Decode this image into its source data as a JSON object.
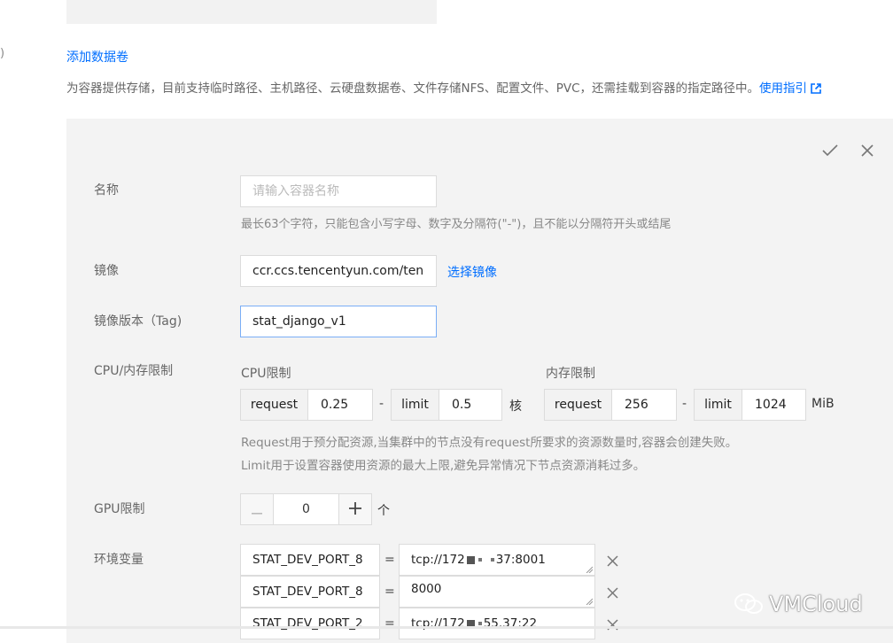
{
  "add_volume": {
    "link": "添加数据卷",
    "description": "为容器提供存储，目前支持临时路径、主机路径、云硬盘数据卷、文件存储NFS、配置文件、PVC，还需挂载到容器的指定路径中。",
    "guide_link": "使用指引"
  },
  "left_marker": ")",
  "container": {
    "name": {
      "label": "名称",
      "placeholder": "请输入容器名称",
      "hint": "最长63个字符，只能包含小写字母、数字及分隔符(\"-\")，且不能以分隔符开头或结尾"
    },
    "image": {
      "label": "镜像",
      "value": "ccr.ccs.tencentyun.com/tence",
      "select_link": "选择镜像"
    },
    "tag": {
      "label": "镜像版本（Tag)",
      "value": "stat_django_v1"
    },
    "resources": {
      "label": "CPU/内存限制",
      "cpu": {
        "title": "CPU限制",
        "request_label": "request",
        "request_value": "0.25",
        "limit_label": "limit",
        "limit_value": "0.5",
        "unit": "核"
      },
      "memory": {
        "title": "内存限制",
        "request_label": "request",
        "request_value": "256",
        "limit_label": "limit",
        "limit_value": "1024",
        "unit": "MiB"
      },
      "dash": "-",
      "hint_line1": "Request用于预分配资源,当集群中的节点没有request所要求的资源数量时,容器会创建失败。",
      "hint_line2": "Limit用于设置容器使用资源的最大上限,避免异常情况下节点资源消耗过多。"
    },
    "gpu": {
      "label": "GPU限制",
      "value": "0",
      "unit": "个"
    },
    "env": {
      "label": "环境变量",
      "equals": "=",
      "rows": [
        {
          "key": "STAT_DEV_PORT_8",
          "value_prefix": "tcp://172",
          "value_suffix": "37:8001"
        },
        {
          "key": "STAT_DEV_PORT_8",
          "value_prefix": "8000",
          "value_suffix": ""
        },
        {
          "key": "STAT_DEV_PORT_2",
          "value_prefix": "tcp://172",
          "value_suffix": "55.37:22"
        }
      ]
    }
  },
  "watermark": "VMCloud",
  "colors": {
    "link": "#006eff",
    "panel_bg": "#f3f3f3",
    "border": "#dcdcdc",
    "focus_border": "#7aaef6"
  },
  "icons": {
    "confirm": "check-icon",
    "close": "close-icon",
    "external": "external-link-icon",
    "minus": "minus-icon",
    "plus": "plus-icon",
    "remove": "close-icon"
  }
}
